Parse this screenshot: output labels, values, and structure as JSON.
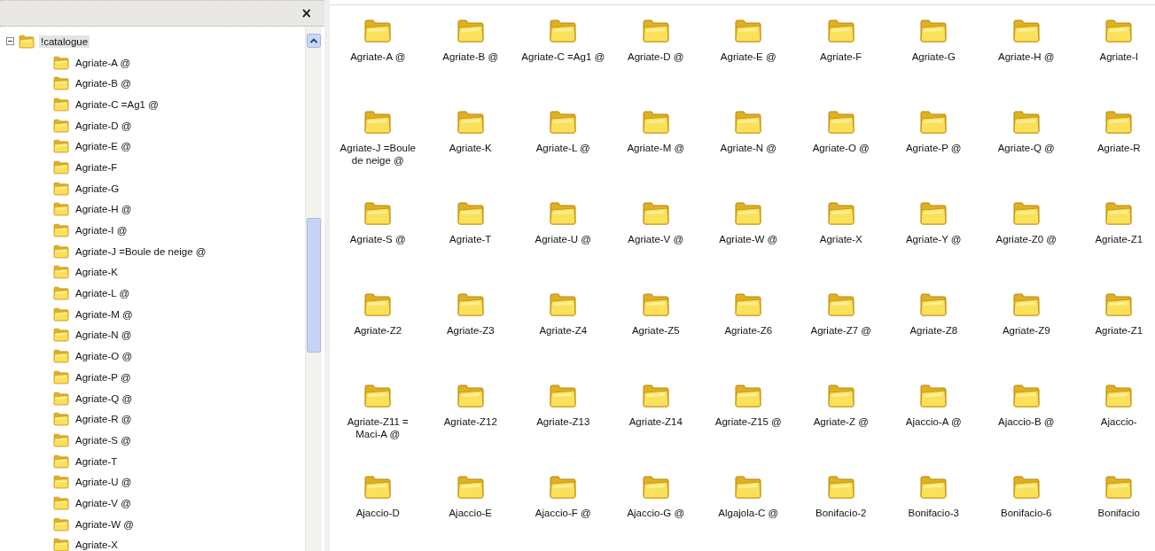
{
  "panel": {
    "close_label": "×"
  },
  "tree": {
    "label": "!catalogue",
    "expanded": true,
    "selected": true,
    "children": [
      {
        "label": "Agriate-A @",
        "selected": false
      },
      {
        "label": "Agriate-B @",
        "selected": false
      },
      {
        "label": "Agriate-C =Ag1 @",
        "selected": false
      },
      {
        "label": "Agriate-D @",
        "selected": false
      },
      {
        "label": "Agriate-E @",
        "selected": false
      },
      {
        "label": "Agriate-F",
        "selected": false
      },
      {
        "label": "Agriate-G",
        "selected": false
      },
      {
        "label": "Agriate-H @",
        "selected": false
      },
      {
        "label": "Agriate-I @",
        "selected": false
      },
      {
        "label": "Agriate-J =Boule de neige @",
        "selected": false
      },
      {
        "label": "Agriate-K",
        "selected": false
      },
      {
        "label": "Agriate-L @",
        "selected": false
      },
      {
        "label": "Agriate-M @",
        "selected": false
      },
      {
        "label": "Agriate-N @",
        "selected": false
      },
      {
        "label": "Agriate-O @",
        "selected": false
      },
      {
        "label": "Agriate-P @",
        "selected": false
      },
      {
        "label": "Agriate-Q @",
        "selected": false
      },
      {
        "label": "Agriate-R @",
        "selected": false
      },
      {
        "label": "Agriate-S @",
        "selected": false
      },
      {
        "label": "Agriate-T",
        "selected": false
      },
      {
        "label": "Agriate-U @",
        "selected": false
      },
      {
        "label": "Agriate-V @",
        "selected": false
      },
      {
        "label": "Agriate-W @",
        "selected": false
      },
      {
        "label": "Agriate-X",
        "selected": false
      }
    ]
  },
  "folders": [
    {
      "name": "Agriate-A @"
    },
    {
      "name": "Agriate-B @"
    },
    {
      "name": "Agriate-C =Ag1 @"
    },
    {
      "name": "Agriate-D @"
    },
    {
      "name": "Agriate-E @"
    },
    {
      "name": "Agriate-F"
    },
    {
      "name": "Agriate-G"
    },
    {
      "name": "Agriate-H @"
    },
    {
      "name": "Agriate-I"
    },
    {
      "name": "Agriate-J =Boule de neige @"
    },
    {
      "name": "Agriate-K"
    },
    {
      "name": "Agriate-L @"
    },
    {
      "name": "Agriate-M @"
    },
    {
      "name": "Agriate-N @"
    },
    {
      "name": "Agriate-O @"
    },
    {
      "name": "Agriate-P @"
    },
    {
      "name": "Agriate-Q @"
    },
    {
      "name": "Agriate-R"
    },
    {
      "name": "Agriate-S @"
    },
    {
      "name": "Agriate-T"
    },
    {
      "name": "Agriate-U @"
    },
    {
      "name": "Agriate-V @"
    },
    {
      "name": "Agriate-W @"
    },
    {
      "name": "Agriate-X"
    },
    {
      "name": "Agriate-Y @"
    },
    {
      "name": "Agriate-Z0 @"
    },
    {
      "name": "Agriate-Z1"
    },
    {
      "name": "Agriate-Z2"
    },
    {
      "name": "Agriate-Z3"
    },
    {
      "name": "Agriate-Z4"
    },
    {
      "name": "Agriate-Z5"
    },
    {
      "name": "Agriate-Z6"
    },
    {
      "name": "Agriate-Z7 @"
    },
    {
      "name": "Agriate-Z8"
    },
    {
      "name": "Agriate-Z9"
    },
    {
      "name": "Agriate-Z1"
    },
    {
      "name": "Agriate-Z11 = Maci-A @"
    },
    {
      "name": "Agriate-Z12"
    },
    {
      "name": "Agriate-Z13"
    },
    {
      "name": "Agriate-Z14"
    },
    {
      "name": "Agriate-Z15 @"
    },
    {
      "name": "Agriate-Z @"
    },
    {
      "name": "Ajaccio-A @"
    },
    {
      "name": "Ajaccio-B @"
    },
    {
      "name": "Ajaccio-"
    },
    {
      "name": "Ajaccio-D"
    },
    {
      "name": "Ajaccio-E"
    },
    {
      "name": "Ajaccio-F @"
    },
    {
      "name": "Ajaccio-G @"
    },
    {
      "name": "Algajola-C @"
    },
    {
      "name": "Bonifacio-2"
    },
    {
      "name": "Bonifacio-3"
    },
    {
      "name": "Bonifacio-6"
    },
    {
      "name": "Bonifacio"
    }
  ]
}
